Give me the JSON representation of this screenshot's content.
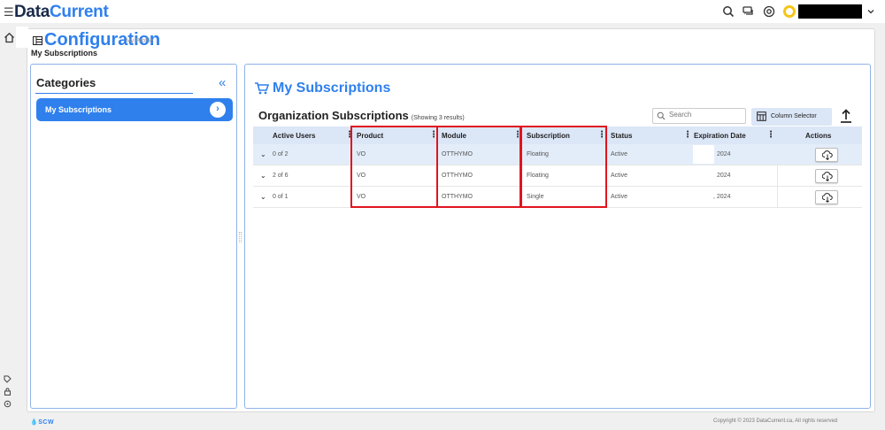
{
  "app": {
    "brand_part1": "Data",
    "brand_part2": "Current"
  },
  "header": {
    "icons": [
      "search-icon",
      "chat-icon",
      "help-icon",
      "user-avatar-icon",
      "chevron-down-icon"
    ],
    "user_name_redacted": true,
    "colors": {
      "brand_blue": "#2f80ed",
      "brand_dark": "#1a2b4a",
      "avatar_ring": "#f5c518"
    }
  },
  "page": {
    "title": "Configuration",
    "subtitle": "My Profile",
    "breadcrumb": "My Subscriptions"
  },
  "categories": {
    "title": "Categories",
    "collapse_label": "«",
    "items": [
      {
        "label": "My Subscriptions",
        "active": true
      }
    ]
  },
  "main": {
    "title": "My Subscriptions",
    "section_title": "Organization Subscriptions",
    "count_label": "(Showing 3 results)",
    "search_placeholder": "Search",
    "column_selector_label": "Column Selector",
    "table": {
      "columns": [
        "Active Users",
        "Product",
        "Module",
        "Subscription",
        "Status",
        "Expiration Date",
        "Actions"
      ],
      "rows": [
        {
          "active_users": "0 of 2",
          "product": "VO",
          "module": "OTTHYMO",
          "subscription": "Floating",
          "status": "Active",
          "expiration": "2024"
        },
        {
          "active_users": "2 of 6",
          "product": "VO",
          "module": "OTTHYMO",
          "subscription": "Floating",
          "status": "Active",
          "expiration": "2024"
        },
        {
          "active_users": "0 of 1",
          "product": "VO",
          "module": "OTTHYMO",
          "subscription": "Single",
          "status": "Active",
          "expiration": ", 2024"
        }
      ]
    }
  },
  "footer": {
    "logo_text": "SCW",
    "copyright": "Copyright © 2023 DataCurrent.ca, All rights reserved"
  }
}
